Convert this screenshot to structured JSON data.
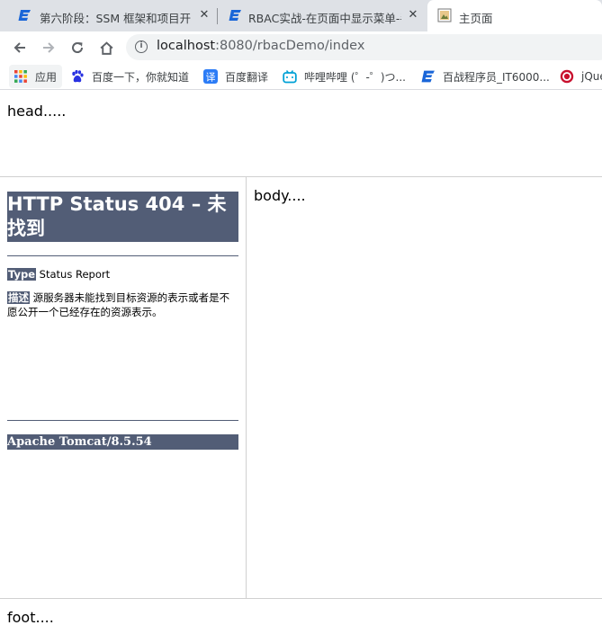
{
  "browser": {
    "tabs": [
      {
        "title": "第六阶段：SSM 框架和项目开发",
        "active": false
      },
      {
        "title": "RBAC实战-在页面中显示菜单-手",
        "active": false
      },
      {
        "title": "主页面",
        "active": true
      }
    ],
    "address": {
      "host": "localhost",
      "path": ":8080/rbacDemo/index"
    },
    "bookmarks": [
      {
        "label": "应用",
        "icon": "apps-grid-icon"
      },
      {
        "label": "百度一下，你就知道",
        "icon": "baidu-paw-icon"
      },
      {
        "label": "百度翻译",
        "icon": "baidu-translate-icon"
      },
      {
        "label": "哔哩哔哩 (゜-゜)つ...",
        "icon": "bilibili-tv-icon"
      },
      {
        "label": "百战程序员_IT6000...",
        "icon": "bjsxt-logo-icon"
      },
      {
        "label": "jQue",
        "icon": "jquery-logo-icon"
      }
    ]
  },
  "frames": {
    "head": "head.....",
    "body": "body....",
    "foot": "foot...."
  },
  "error_page": {
    "title": "HTTP Status 404 – 未找到",
    "type_label": "Type",
    "type_value": "Status Report",
    "desc_label": "描述",
    "desc_value": "源服务器未能找到目标资源的表示或者是不愿公开一个已经存在的资源表示。",
    "server": "Apache Tomcat/8.5.54"
  },
  "colors": {
    "tomcat_header": "#525d76",
    "tab_strip": "#dee1e6",
    "favicon_blue": "#1a66d8"
  }
}
